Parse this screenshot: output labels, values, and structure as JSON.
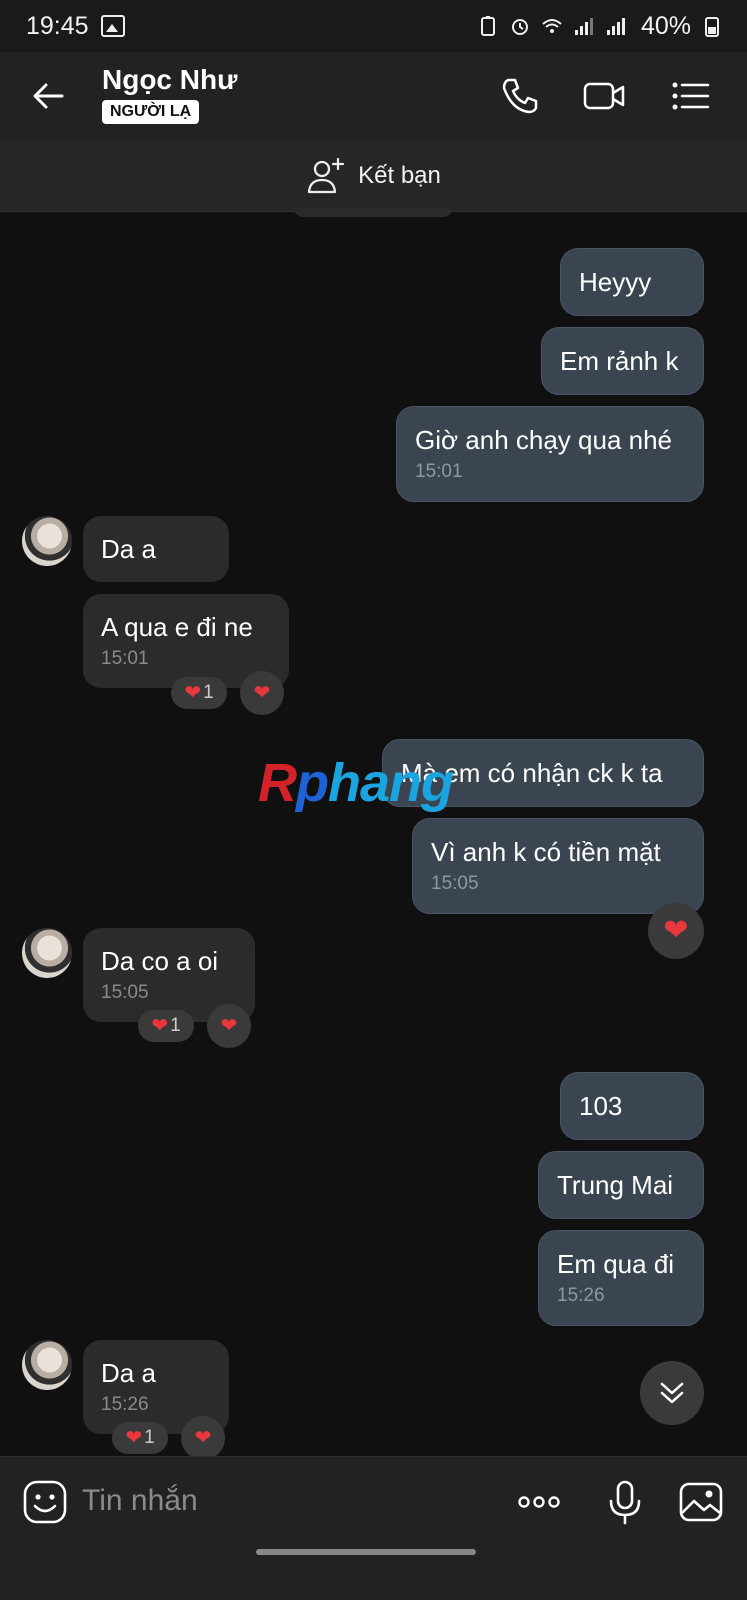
{
  "status_bar": {
    "time": "19:45",
    "battery": "40%"
  },
  "header": {
    "contact_name": "Ngọc Như",
    "badge": "NGƯỜI LẠ",
    "icons": [
      "back-arrow-icon",
      "phone-icon",
      "video-call-icon",
      "menu-list-icon"
    ]
  },
  "add_friend": {
    "label": "Kết bạn",
    "icon": "add-user-icon"
  },
  "messages": [
    {
      "dir": "out",
      "text": "Heyyy"
    },
    {
      "dir": "out",
      "text": "Em rảnh k"
    },
    {
      "dir": "out",
      "text": "Giờ anh chạy qua nhé",
      "time": "15:01"
    },
    {
      "dir": "in",
      "text": "Da a"
    },
    {
      "dir": "in",
      "text": "A qua e đi ne",
      "time": "15:01",
      "reaction_count": "1"
    },
    {
      "dir": "out",
      "text": "Mà em có nhận ck k ta"
    },
    {
      "dir": "out",
      "text": "Vì anh k có tiền mặt",
      "time": "15:05"
    },
    {
      "dir": "in",
      "text": "Da co a oi",
      "time": "15:05",
      "reaction_count": "1"
    },
    {
      "dir": "out",
      "text": "103"
    },
    {
      "dir": "out",
      "text": "Trung Mai"
    },
    {
      "dir": "out",
      "text": "Em qua đi",
      "time": "15:26"
    },
    {
      "dir": "in",
      "text": "Da a",
      "time": "15:26",
      "reaction_count": "1"
    }
  ],
  "watermark": {
    "part1": "R",
    "part2": "p",
    "part3": "hang"
  },
  "composer": {
    "placeholder": "Tin nhắn",
    "icons": [
      "emoji-icon",
      "more-dots-icon",
      "microphone-icon",
      "image-icon"
    ]
  },
  "colors": {
    "outgoing_bubble": "#3b4552",
    "incoming_bubble": "#2b2b2b",
    "heart": "#e8383d",
    "background": "#101010"
  }
}
